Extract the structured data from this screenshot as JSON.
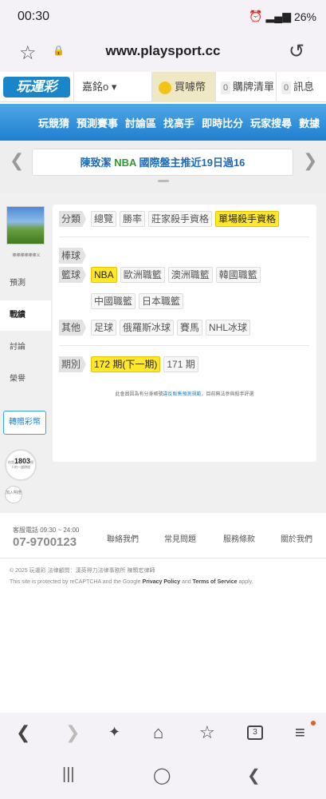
{
  "status": {
    "time": "00:30",
    "battery": "26%"
  },
  "browser": {
    "url": "www.playsport.cc"
  },
  "site": {
    "logo": "玩運彩",
    "user": "嘉銘o ▾",
    "buy": "買噱幣",
    "cart_count": "0",
    "cart": "購牌清單",
    "msg_count": "0",
    "msg": "訊息"
  },
  "nav": {
    "items": [
      "玩競猜",
      "預測賽事",
      "討論區",
      "找高手",
      "即時比分",
      "玩家搜尋",
      "數據"
    ]
  },
  "banner": {
    "pre": "陳致潔 ",
    "highlight": "NBA",
    "post": " 國際盤主推近19日過16"
  },
  "sidebar": {
    "avatar_label": "棒棒棒棒棒棒义",
    "items": [
      "預測",
      "戰績",
      "討論",
      "榮譽"
    ],
    "transfer": "轉贈彩幣",
    "stat_prefix": "你是",
    "stat_num": "1803",
    "stat_suffix": "個",
    "stat_label": "人的一週明燈",
    "add": "加入明燈"
  },
  "panel": {
    "category_label": "分類",
    "categories": [
      "總覽",
      "勝率",
      "莊家殺手資格",
      "單場殺手資格"
    ],
    "baseball_label": "棒球",
    "basketball_label": "籃球",
    "basketball": [
      "NBA",
      "歐洲職籃",
      "澳洲職籃",
      "韓國職籃",
      "中國職籃",
      "日本職籃"
    ],
    "other_label": "其他",
    "other": [
      "足球",
      "俄羅斯冰球",
      "賽馬",
      "NHL冰球"
    ],
    "period_label": "期別",
    "periods": [
      "172 期(下一期)",
      "171 期"
    ],
    "notice_pre": "此會員因為有分身帳號",
    "notice_link": "違反販售預測規範",
    "notice_post": "，目前無法參與殺手評選"
  },
  "footer": {
    "phone_label": "客服電話 09:30 ~ 24:00",
    "phone": "07-9700123",
    "links": [
      "聯絡我們",
      "常見問題",
      "服務條款",
      "關於我們"
    ],
    "copyright": "© 2025 玩運彩 法律顧問：漢英得力法律事務所 陳顥宏律師",
    "captcha_pre": "This site is protected by reCAPTCHA and the Google ",
    "privacy": "Privacy Policy",
    "and": " and ",
    "terms": "Terms of Service",
    "apply": " apply."
  },
  "toolbar": {
    "tabs": "3"
  }
}
